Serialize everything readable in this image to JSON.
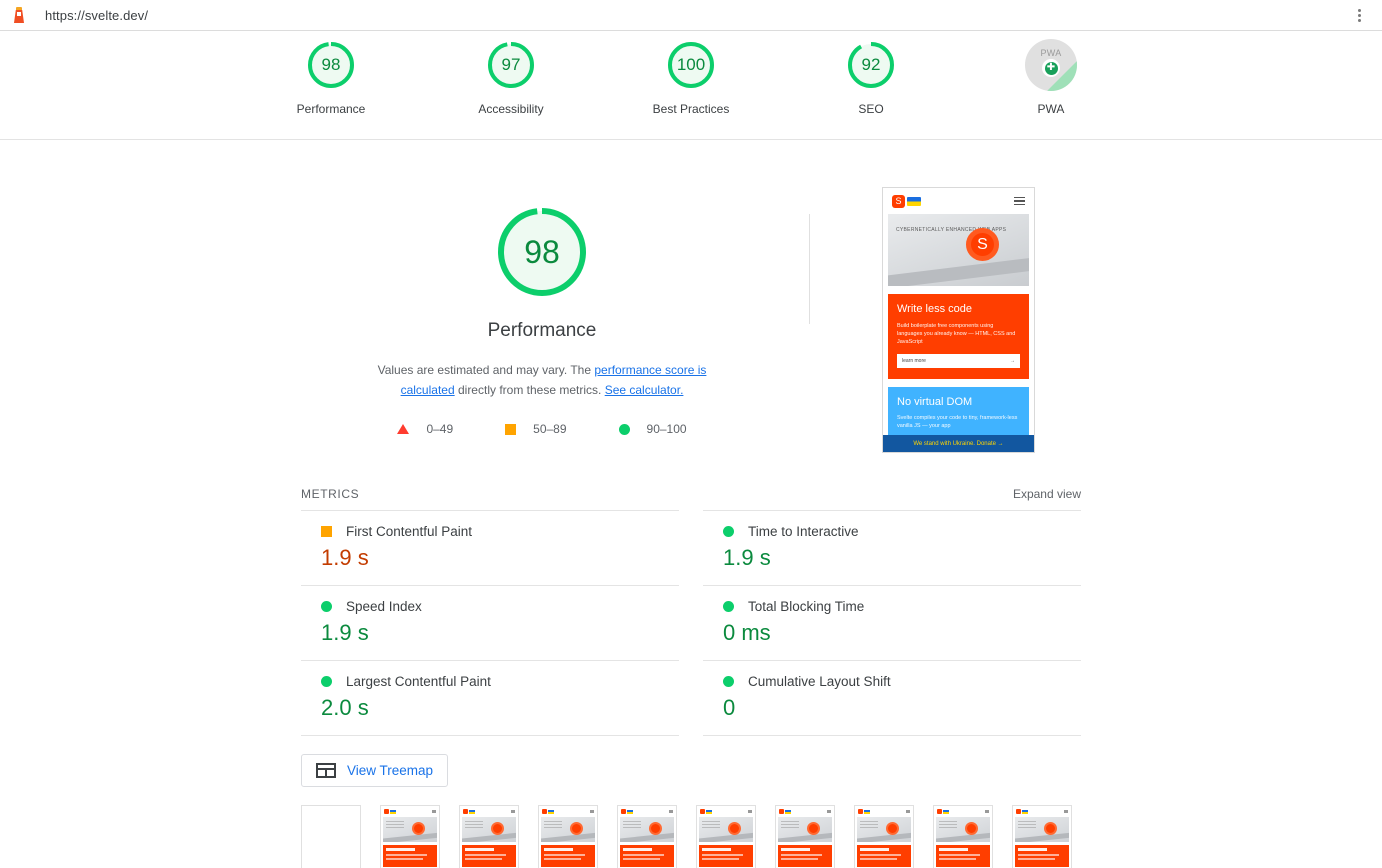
{
  "browser": {
    "url": "https://svelte.dev/",
    "favicon_icon": "lighthouse-icon",
    "menu_icon": "three-dot-menu-icon"
  },
  "score_bar": {
    "categories": [
      {
        "label": "Performance",
        "score": "98",
        "numeric": 98
      },
      {
        "label": "Accessibility",
        "score": "97",
        "numeric": 97
      },
      {
        "label": "Best Practices",
        "score": "100",
        "numeric": 100
      },
      {
        "label": "SEO",
        "score": "92",
        "numeric": 92
      }
    ],
    "pwa": {
      "label": "PWA",
      "badge_text": "PWA",
      "check": "✚"
    }
  },
  "hero": {
    "gauge_score": "98",
    "gauge_numeric": 98,
    "title": "Performance",
    "description_pre": "Values are estimated and may vary. The ",
    "link_calculated": "performance score is calculated",
    "description_mid": " directly from these metrics. ",
    "link_calculator": "See calculator.",
    "legend": [
      {
        "icon": "triangle-red-icon",
        "range": "0–49"
      },
      {
        "icon": "square-orange-icon",
        "range": "50–89"
      },
      {
        "icon": "circle-green-icon",
        "range": "90–100"
      }
    ]
  },
  "screenshot": {
    "nav_logo": "svelte-logo-icon",
    "flag": "ukraine-flag-icon",
    "menu": "hamburger-icon",
    "hero_text": "CYBERNETICALLY ENHANCED WEB APPS",
    "card1_title": "Write less code",
    "card1_body": "Build boilerplate free components using languages you already know — HTML, CSS and JavaScript",
    "card1_button": "learn more",
    "card1_arrow": "→",
    "card2_title": "No virtual DOM",
    "card2_body": "Svelte compiles your code to tiny, framework-less vanilla JS — your app",
    "banner": "We stand with Ukraine. Donate →"
  },
  "metrics": {
    "heading": "METRICS",
    "expand_label": "Expand view",
    "left": [
      {
        "label": "First Contentful Paint",
        "value": "1.9 s",
        "status": "orange"
      },
      {
        "label": "Speed Index",
        "value": "1.9 s",
        "status": "green"
      },
      {
        "label": "Largest Contentful Paint",
        "value": "2.0 s",
        "status": "green"
      }
    ],
    "right": [
      {
        "label": "Time to Interactive",
        "value": "1.9 s",
        "status": "green"
      },
      {
        "label": "Total Blocking Time",
        "value": "0 ms",
        "status": "green"
      },
      {
        "label": "Cumulative Layout Shift",
        "value": "0",
        "status": "green"
      }
    ]
  },
  "treemap": {
    "label": "View Treemap",
    "icon": "treemap-icon"
  },
  "filmstrip": {
    "frames": [
      {
        "state": "blank"
      },
      {
        "state": "loaded"
      },
      {
        "state": "loaded"
      },
      {
        "state": "loaded"
      },
      {
        "state": "loaded"
      },
      {
        "state": "loaded"
      },
      {
        "state": "loaded"
      },
      {
        "state": "loaded"
      },
      {
        "state": "loaded"
      },
      {
        "state": "loaded"
      }
    ]
  },
  "colors": {
    "pass": "#0cce6b",
    "average": "#ffa400",
    "fail": "#ff3c2f",
    "pass_text": "#0b8a3e",
    "average_text": "#c33c00",
    "link": "#1a73e8"
  }
}
